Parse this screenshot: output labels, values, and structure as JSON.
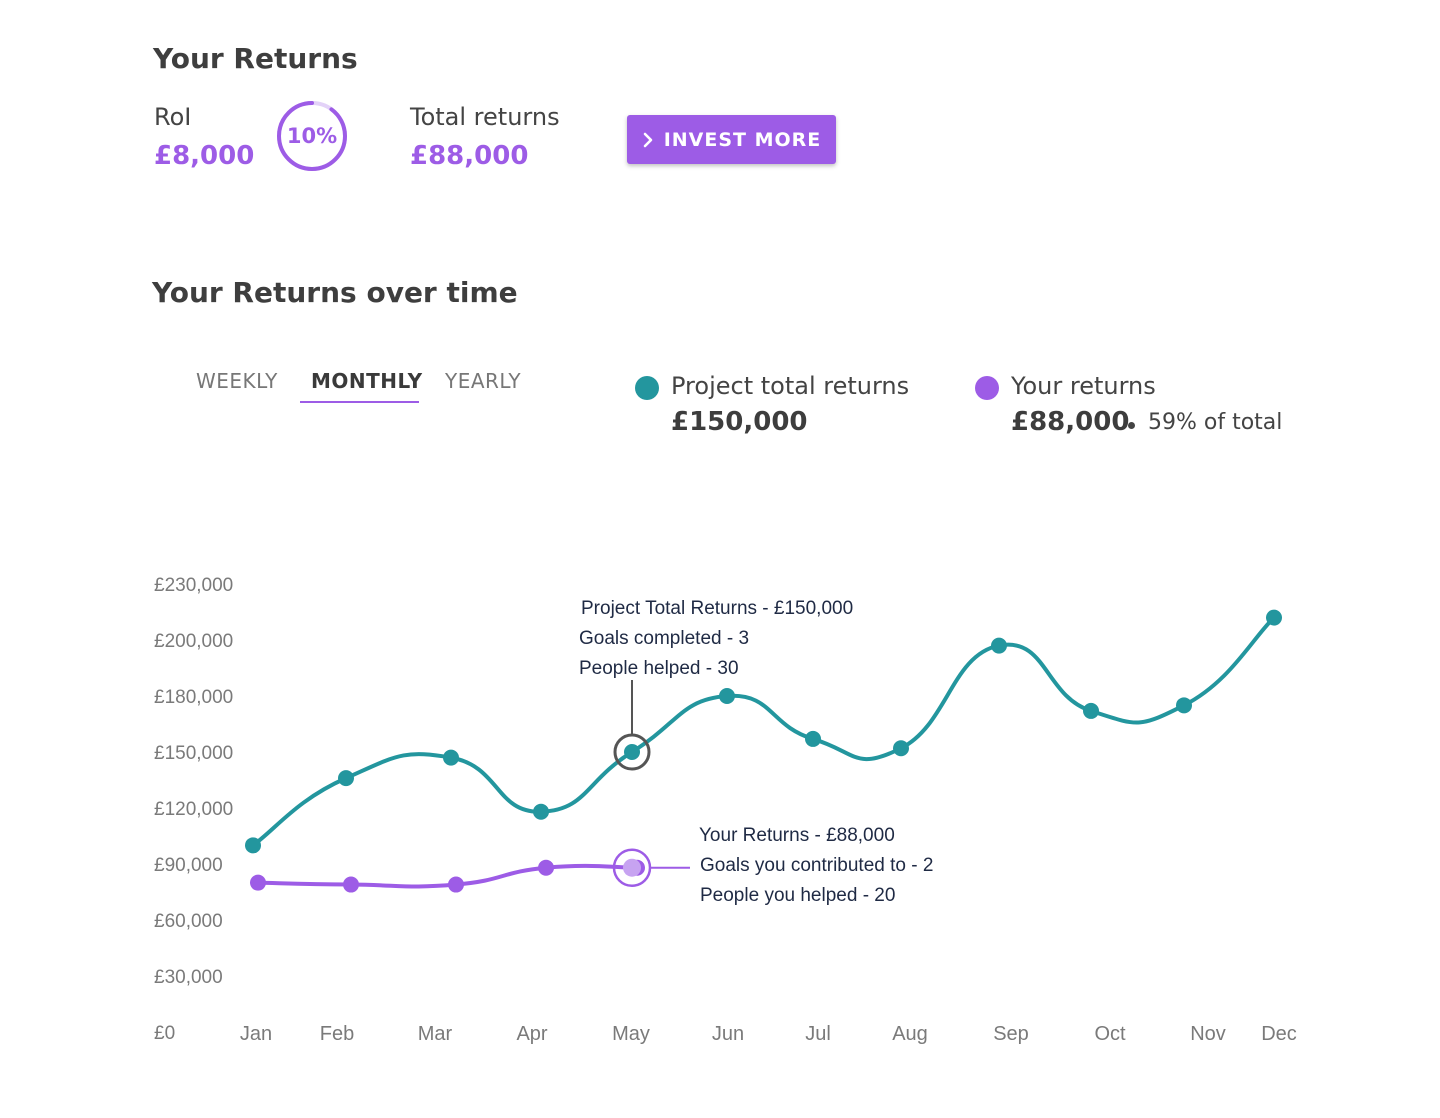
{
  "summary": {
    "title": "Your Returns",
    "roi_label": "RoI",
    "roi_value": "£8,000",
    "roi_percent_label": "10%",
    "roi_percent": 0.1,
    "total_label": "Total returns",
    "total_value": "£88,000",
    "invest_button": "INVEST MORE"
  },
  "chart_section": {
    "title": "Your Returns over time",
    "tabs": [
      "WEEKLY",
      "MONTHLY",
      "YEARLY"
    ],
    "active_tab": "MONTHLY"
  },
  "legend": [
    {
      "name": "Project total returns",
      "value": "£150,000",
      "note": "",
      "color": "#23969e"
    },
    {
      "name": "Your returns",
      "value": "£88,000",
      "note": "59% of total",
      "color": "#9d5ce6"
    }
  ],
  "chart_data": {
    "type": "line",
    "categories": [
      "Jan",
      "Feb",
      "Mar",
      "Apr",
      "May",
      "Jun",
      "Jul",
      "Aug",
      "Sep",
      "Oct",
      "Nov",
      "Dec"
    ],
    "y_ticks": [
      "£0",
      "£30,000",
      "£60,000",
      "£90,000",
      "£120,000",
      "£150,000",
      "£180,000",
      "£200,000",
      "£230,000"
    ],
    "series": [
      {
        "name": "Project total returns",
        "color": "#23969e",
        "values": [
          100000,
          136000,
          147000,
          118000,
          150000,
          180000,
          157000,
          152000,
          198000,
          172000,
          175000,
          212000
        ]
      },
      {
        "name": "Your returns",
        "color": "#9d5ce6",
        "values": [
          80000,
          79000,
          79000,
          88000,
          88000,
          null,
          null,
          null,
          null,
          null,
          null,
          null
        ]
      }
    ],
    "annotations": [
      {
        "series": 0,
        "category": "May",
        "lines": [
          "Project Total Returns - £150,000",
          "Goals completed - 3",
          "People helped - 30"
        ]
      },
      {
        "series": 1,
        "category": "May",
        "lines": [
          "Your Returns - £88,000",
          "Goals you contributed to - 2",
          "People you helped - 20"
        ]
      }
    ]
  }
}
